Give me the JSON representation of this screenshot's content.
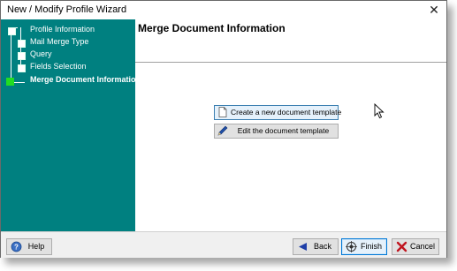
{
  "window": {
    "title": "New / Modify Profile Wizard",
    "close_glyph": "✕"
  },
  "sidebar": {
    "background": "#008080",
    "steps": [
      {
        "label": "Profile Information",
        "active": false
      },
      {
        "label": "Mail Merge Type",
        "active": false
      },
      {
        "label": "Query",
        "active": false
      },
      {
        "label": "Fields Selection",
        "active": false
      },
      {
        "label": "Merge Document Information",
        "active": true
      }
    ]
  },
  "content": {
    "title": "Merge Document Information",
    "options": [
      {
        "label": "Create a new document template",
        "icon": "document-icon"
      },
      {
        "label": "Edit the document template",
        "icon": "edit-pen-icon"
      }
    ]
  },
  "footer": {
    "help_label": "Help",
    "back_label": "Back",
    "finish_label": "Finish",
    "cancel_label": "Cancel"
  }
}
